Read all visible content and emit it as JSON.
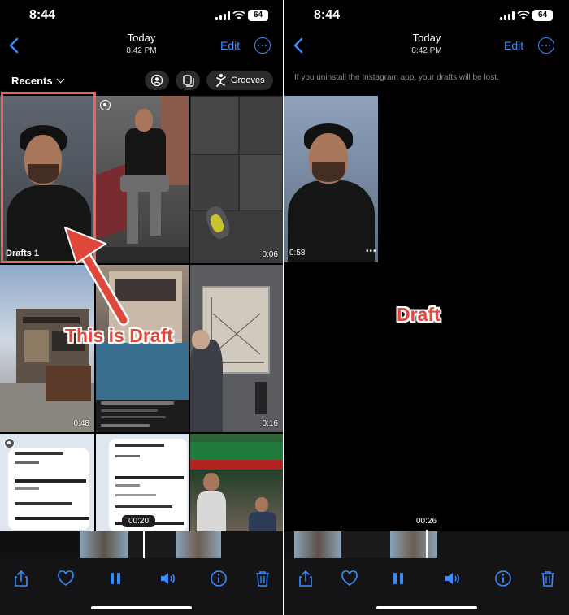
{
  "left": {
    "status": {
      "time": "8:44",
      "battery": "64"
    },
    "nav": {
      "title": "Today",
      "subtitle": "8:42 PM",
      "edit": "Edit"
    },
    "recents": {
      "label": "Recents",
      "grooves": "Grooves"
    },
    "grid": {
      "drafts_label": "Drafts 1",
      "durations": [
        "0:06",
        "0:48",
        "0:16"
      ],
      "scrub_time": "00:20"
    },
    "annotation": "This is Draft"
  },
  "right": {
    "status": {
      "time": "8:44",
      "battery": "64"
    },
    "nav": {
      "title": "Today",
      "subtitle": "8:42 PM",
      "edit": "Edit"
    },
    "info": "If you uninstall the Instagram app, your drafts will be lost.",
    "draft_duration": "0:58",
    "annotation": "Draft",
    "scrub_time": "00:26"
  },
  "colors": {
    "accent": "#3a8dff",
    "annotation": "#e0473b",
    "highlight": "#e8675a"
  },
  "icons": [
    "share-icon",
    "heart-icon",
    "pause-icon",
    "speaker-icon",
    "info-icon",
    "trash-icon"
  ]
}
